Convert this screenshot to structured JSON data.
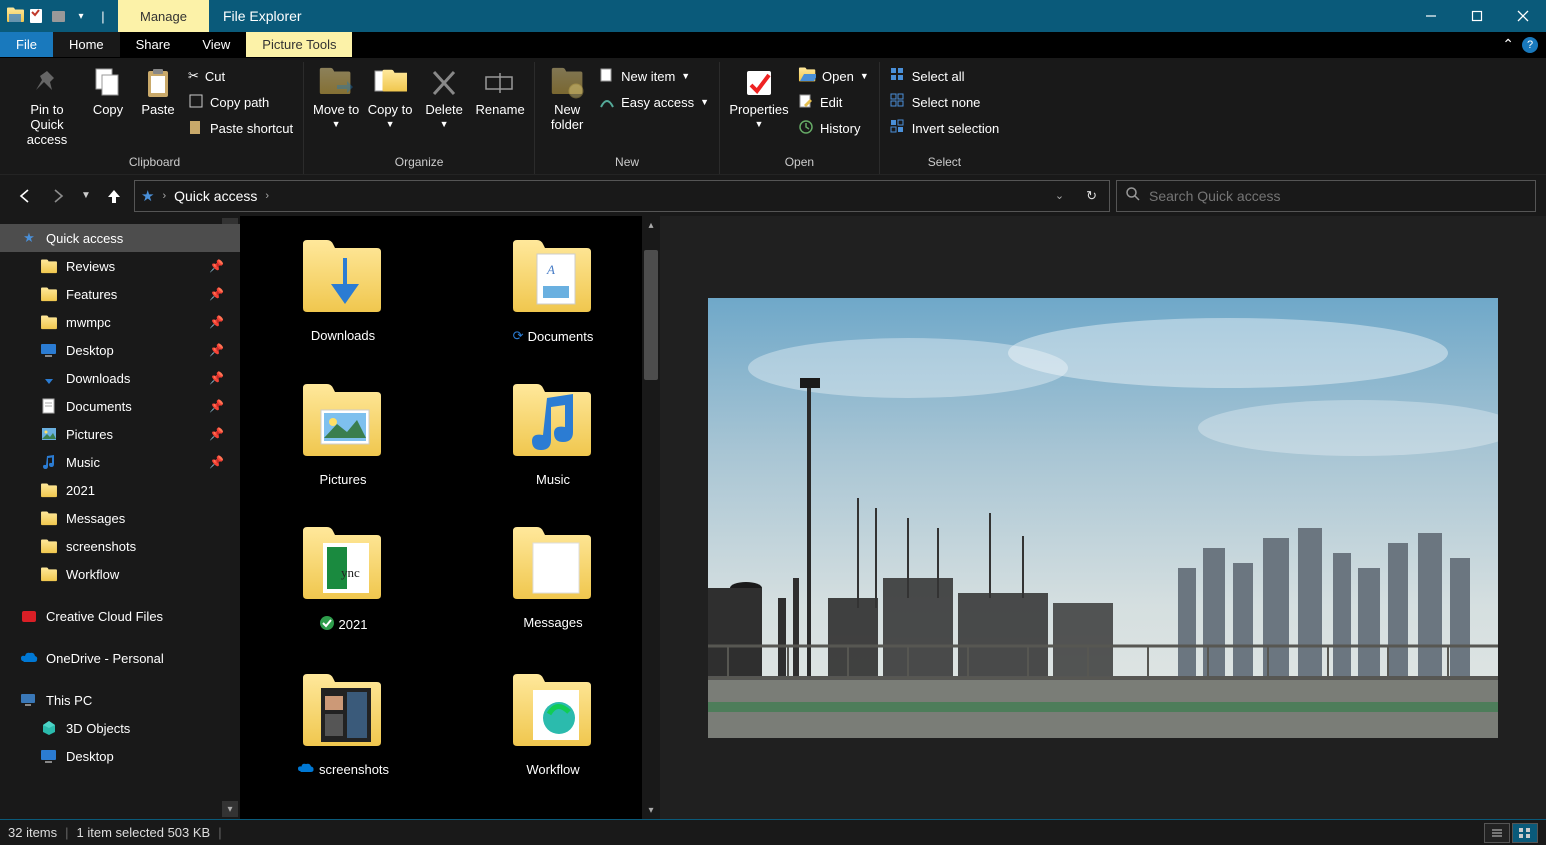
{
  "titlebar": {
    "context_tab": "Manage",
    "app_title": "File Explorer"
  },
  "tabs": {
    "file": "File",
    "home": "Home",
    "share": "Share",
    "view": "View",
    "picture_tools": "Picture Tools"
  },
  "ribbon": {
    "clipboard": {
      "label": "Clipboard",
      "pin": "Pin to Quick access",
      "copy": "Copy",
      "paste": "Paste",
      "cut": "Cut",
      "copy_path": "Copy path",
      "paste_shortcut": "Paste shortcut"
    },
    "organize": {
      "label": "Organize",
      "move_to": "Move to",
      "copy_to": "Copy to",
      "delete": "Delete",
      "rename": "Rename"
    },
    "new": {
      "label": "New",
      "new_folder": "New folder",
      "new_item": "New item",
      "easy_access": "Easy access"
    },
    "open": {
      "label": "Open",
      "properties": "Properties",
      "open": "Open",
      "edit": "Edit",
      "history": "History"
    },
    "select": {
      "label": "Select",
      "select_all": "Select all",
      "select_none": "Select none",
      "invert": "Invert selection"
    }
  },
  "breadcrumb": {
    "location": "Quick access"
  },
  "search": {
    "placeholder": "Search Quick access"
  },
  "tree": {
    "quick_access": "Quick access",
    "items": [
      {
        "label": "Reviews",
        "icon": "folder",
        "pinned": true
      },
      {
        "label": "Features",
        "icon": "folder",
        "pinned": true
      },
      {
        "label": "mwmpc",
        "icon": "folder",
        "pinned": true
      },
      {
        "label": "Desktop",
        "icon": "desktop",
        "pinned": true
      },
      {
        "label": "Downloads",
        "icon": "downloads",
        "pinned": true
      },
      {
        "label": "Documents",
        "icon": "documents",
        "pinned": true
      },
      {
        "label": "Pictures",
        "icon": "pictures",
        "pinned": true
      },
      {
        "label": "Music",
        "icon": "music",
        "pinned": true
      },
      {
        "label": "2021",
        "icon": "folder",
        "pinned": false
      },
      {
        "label": "Messages",
        "icon": "folder",
        "pinned": false
      },
      {
        "label": "screenshots",
        "icon": "folder",
        "pinned": false
      },
      {
        "label": "Workflow",
        "icon": "folder",
        "pinned": false
      }
    ],
    "creative_cloud": "Creative Cloud Files",
    "onedrive": "OneDrive - Personal",
    "this_pc": "This PC",
    "pc_items": [
      {
        "label": "3D Objects",
        "icon": "3dobjects"
      },
      {
        "label": "Desktop",
        "icon": "desktop"
      }
    ]
  },
  "grid": {
    "items": [
      {
        "label": "Downloads",
        "icon": "downloads",
        "badge": ""
      },
      {
        "label": "Documents",
        "icon": "documents",
        "badge": "sync"
      },
      {
        "label": "Pictures",
        "icon": "pictures",
        "badge": ""
      },
      {
        "label": "Music",
        "icon": "music",
        "badge": ""
      },
      {
        "label": "2021",
        "icon": "folder-thumb-green",
        "badge": "check"
      },
      {
        "label": "Messages",
        "icon": "folder-thumb-white",
        "badge": ""
      },
      {
        "label": "screenshots",
        "icon": "folder-thumb-dark",
        "badge": "cloud"
      },
      {
        "label": "Workflow",
        "icon": "folder-thumb-blue",
        "badge": ""
      }
    ]
  },
  "status": {
    "count": "32 items",
    "selection": "1 item selected  503 KB"
  }
}
